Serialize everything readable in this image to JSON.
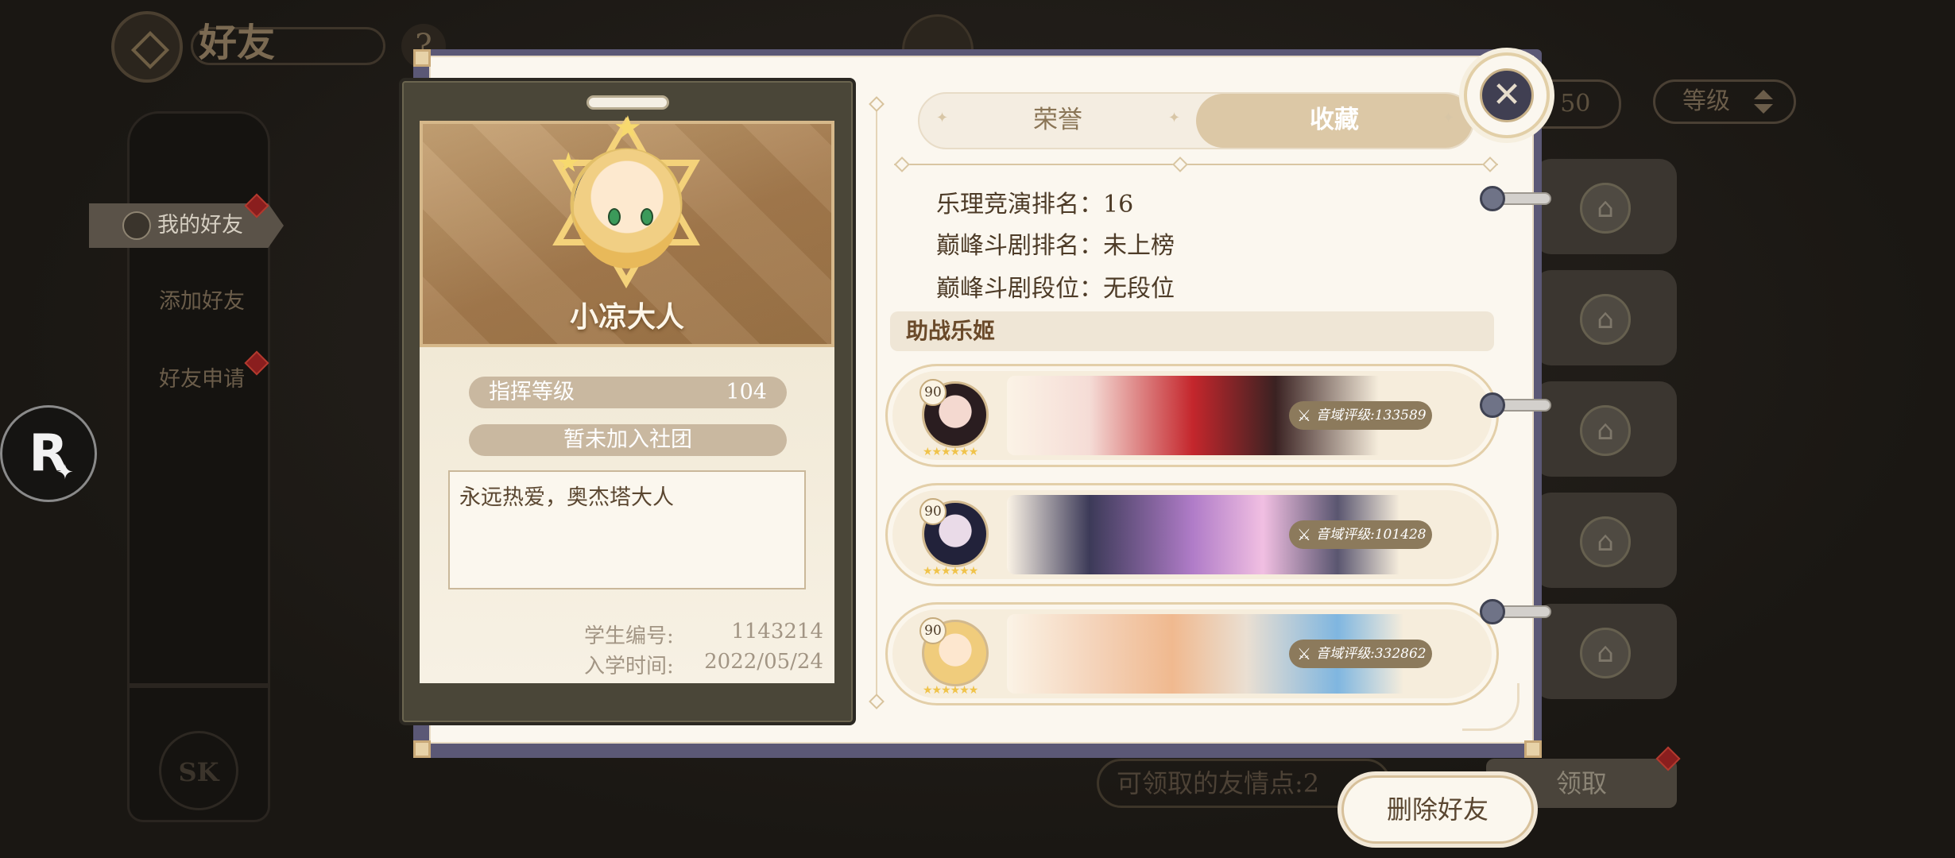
{
  "background": {
    "title": "好友",
    "help": "?",
    "sidebar": {
      "items": [
        {
          "label": "我的好友"
        },
        {
          "label": "添加好友"
        },
        {
          "label": "好友申请"
        }
      ],
      "emblem": "SK"
    },
    "friend_count": "/ 50",
    "sort_label": "等级",
    "friendship_points_label": "可领取的友情点:2",
    "claim_label": "领取",
    "r_badge": "R"
  },
  "profile": {
    "name": "小凉大人",
    "level_label": "指挥等级",
    "level_value": "104",
    "club_status": "暂未加入社团",
    "signature": "永远热爱，奥杰塔大人",
    "student_id_label": "学生编号:",
    "student_id": "1143214",
    "enroll_label": "入学时间:",
    "enroll_date": "2022/05/24"
  },
  "tabs": {
    "honor": "荣誉",
    "collection": "收藏"
  },
  "stats": {
    "contest_rank": "乐理竞演排名：16",
    "peak_drama_rank": "巅峰斗剧排名：未上榜",
    "peak_drama_tier": "巅峰斗剧段位：无段位"
  },
  "support": {
    "title": "助战乐姬",
    "idols": [
      {
        "level": "90",
        "stars": "★★★★★★",
        "score": "音域评级:133589",
        "color": "#c4262c"
      },
      {
        "level": "90",
        "stars": "★★★★★★",
        "score": "音域评级:101428",
        "color": "#b07cc8"
      },
      {
        "level": "90",
        "stars": "★★★★★★",
        "score": "音域评级:332862",
        "color": "#7fb6e0"
      }
    ]
  },
  "actions": {
    "delete_friend": "删除好友"
  },
  "icons": {
    "close": "close-icon",
    "home": "home-icon",
    "swords": "swords-icon"
  }
}
